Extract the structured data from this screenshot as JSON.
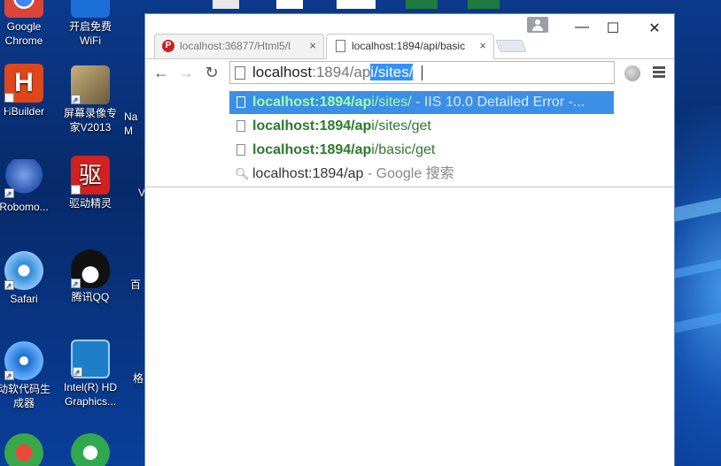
{
  "desktop": {
    "icons": [
      {
        "label1": "Google",
        "label2": "Chrome",
        "color": "#d8d8d8"
      },
      {
        "label1": "开启免费",
        "label2": "WiFi",
        "color": "#1d6fd8"
      },
      {
        "label1": "HBuilder",
        "label2": "",
        "color": "#e0461b"
      },
      {
        "label1": "屏幕录像专",
        "label2": "家V2013",
        "color": "#d8c9a0"
      },
      {
        "label1": "Robomo...",
        "label2": "",
        "color": "#2c56b0"
      },
      {
        "label1": "驱动精灵",
        "label2": "",
        "color": "#d32020"
      },
      {
        "label1": "Safari",
        "label2": "",
        "color": "#2f8ad8"
      },
      {
        "label1": "腾讯QQ",
        "label2": "",
        "color": "#111111"
      },
      {
        "label1": "动软代码生",
        "label2": "成器",
        "color": "#1a6fd0"
      },
      {
        "label1": "Intel(R) HD",
        "label2": "Graphics...",
        "color": "#1e7fc8"
      }
    ],
    "partial": [
      {
        "label1": "Na",
        "label2": "M"
      },
      {
        "label1": "V",
        "label2": ""
      },
      {
        "label1": "百",
        "label2": ""
      },
      {
        "label1": "格",
        "label2": ""
      }
    ]
  },
  "browser": {
    "tabs": [
      {
        "label": "localhost:36877/Html5/l",
        "active": false
      },
      {
        "label": "localhost:1894/api/basic",
        "active": true
      }
    ],
    "window": {
      "minimize": "—",
      "maximize": "☐",
      "close": "✕"
    },
    "nav": {
      "back": "←",
      "forward": "→",
      "reload": "↻"
    },
    "omnibox": {
      "typed_host": "localhost",
      "typed_port": ":1894/ap",
      "typed_tail": "i",
      "selected": "/sites/"
    },
    "suggestions": [
      {
        "bold": "localhost:1894/ap",
        "rest": "i/sites/",
        "desc": " - IIS 10.0 Detailed Error -...",
        "active": true,
        "icon": "page-icon"
      },
      {
        "bold": "localhost:1894/ap",
        "rest": "i/sites/get",
        "desc": "",
        "active": false,
        "icon": "page-icon"
      },
      {
        "bold": "localhost:1894/ap",
        "rest": "i/basic/get",
        "desc": "",
        "active": false,
        "icon": "page-icon"
      },
      {
        "bold": "",
        "rest": "localhost:1894/ap",
        "desc": " - Google 搜索",
        "active": false,
        "icon": "search-icon"
      }
    ]
  }
}
